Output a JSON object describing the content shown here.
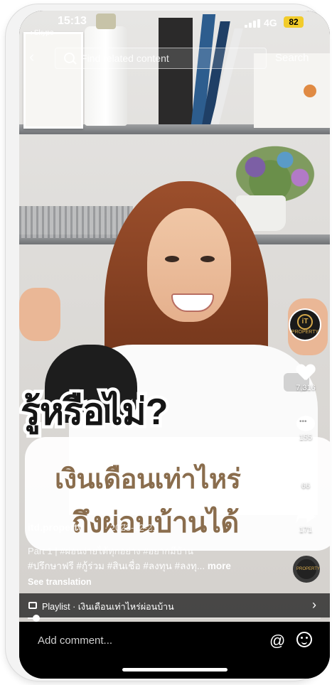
{
  "status_bar": {
    "time": "15:13",
    "back_app": "◂ Skype",
    "network": "4G",
    "battery": "82"
  },
  "search": {
    "placeholder": "Find related content",
    "button": "Search"
  },
  "video": {
    "caption_line1": "รู้หรือไม่?",
    "caption_line2": "เงินเดือนเท่าไหร่",
    "caption_line3": "ถึงผ่อนบ้านได้",
    "brand_logo_text": "PROPERTY"
  },
  "rail": {
    "likes": "7,316",
    "comments": "155",
    "saves": "66",
    "shares": "171"
  },
  "post": {
    "author": "itd.property",
    "date": "· 2023-12-21",
    "description_line1": "Part 1 | #ผ่อนง่ายได้ทุกอย่าง #อยากมีบ้าน",
    "description_line2": "#ปรึกษาฟรี #กู้ร่วม #สินเชื่อ #ลงทุน #ลงทุ...",
    "more": "more",
    "see_translation": "See translation"
  },
  "playlist": {
    "label": "Playlist · เงินเดือนเท่าไหร่ผ่อนบ้าน"
  },
  "progress": 0.03,
  "comment_bar": {
    "placeholder": "Add comment...",
    "at_symbol": "@"
  },
  "colors": {
    "caption_brown": "#8a6d4d",
    "battery_yellow": "#f2cc2b",
    "brand_gold": "#d6a94a"
  }
}
